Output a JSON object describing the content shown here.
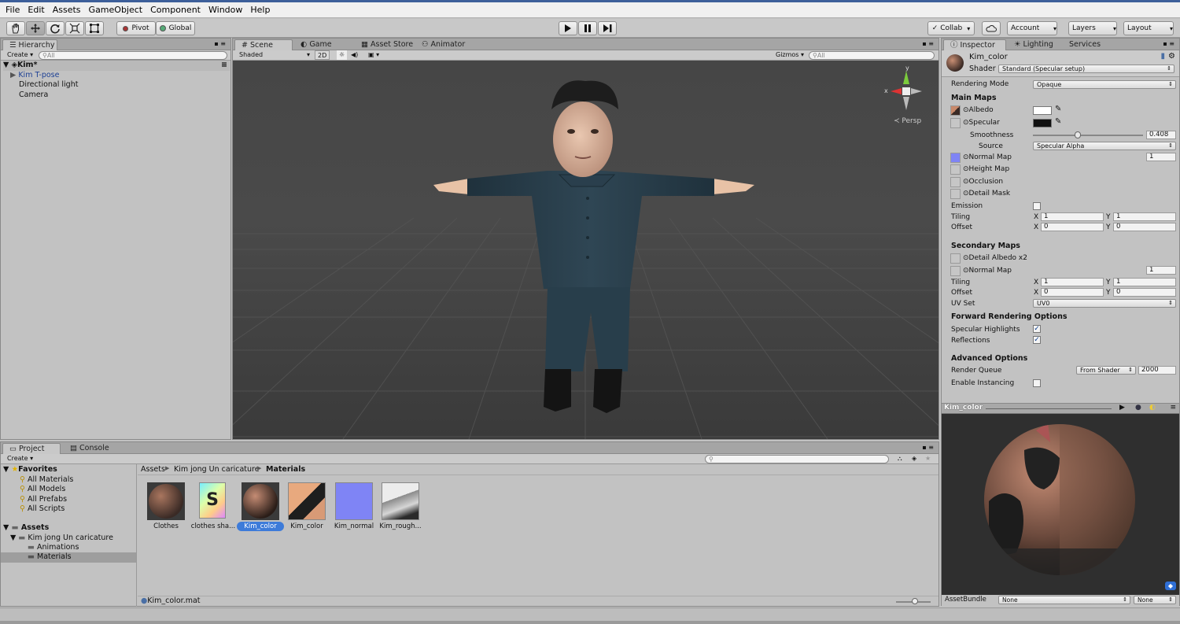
{
  "menu": [
    "File",
    "Edit",
    "Assets",
    "GameObject",
    "Component",
    "Window",
    "Help"
  ],
  "toolbar": {
    "pivot": "Pivot",
    "global": "Global",
    "collab": "Collab",
    "account": "Account",
    "layers": "Layers",
    "layout": "Layout"
  },
  "hierarchy": {
    "tab": "Hierarchy",
    "create": "Create",
    "search_placeholder": "All",
    "scene": "Kim*",
    "items": [
      "Kim T-pose",
      "Directional light",
      "Camera"
    ]
  },
  "scene_view": {
    "tabs": [
      "Scene",
      "Game",
      "Asset Store",
      "Animator"
    ],
    "shading": "Shaded",
    "mode_2d": "2D",
    "gizmos": "Gizmos",
    "search_placeholder": "All",
    "persp": "Persp",
    "axis_y": "y",
    "axis_x": "x"
  },
  "inspector": {
    "tabs": [
      "Inspector",
      "Lighting",
      "Services"
    ],
    "material_name": "Kim_color",
    "shader_label": "Shader",
    "shader_value": "Standard (Specular setup)",
    "rendering_mode_label": "Rendering Mode",
    "rendering_mode_value": "Opaque",
    "main_maps": "Main Maps",
    "albedo": "Albedo",
    "specular": "Specular",
    "smoothness": "Smoothness",
    "smoothness_value": "0.408",
    "smoothness_level": 0.408,
    "source": "Source",
    "source_value": "Specular Alpha",
    "normal_map": "Normal Map",
    "normal_value": "1",
    "height_map": "Height Map",
    "occlusion": "Occlusion",
    "detail_mask": "Detail Mask",
    "emission": "Emission",
    "tiling": "Tiling",
    "offset": "Offset",
    "x": "X",
    "y": "Y",
    "tiling_x": "1",
    "tiling_y": "1",
    "offset_x": "0",
    "offset_y": "0",
    "secondary_maps": "Secondary Maps",
    "detail_albedo": "Detail Albedo x2",
    "normal_map2": "Normal Map",
    "normal2_value": "1",
    "tiling2_x": "1",
    "tiling2_y": "1",
    "offset2_x": "0",
    "offset2_y": "0",
    "uv_set": "UV Set",
    "uv_set_value": "UV0",
    "forward_rendering": "Forward Rendering Options",
    "specular_highlights": "Specular Highlights",
    "reflections": "Reflections",
    "advanced": "Advanced Options",
    "render_queue": "Render Queue",
    "render_queue_mode": "From Shader",
    "render_queue_value": "2000",
    "enable_instancing": "Enable Instancing",
    "preview_title": "Kim_color",
    "asset_bundle": "AssetBundle",
    "bundle_value": "None",
    "bundle_variant": "None"
  },
  "project": {
    "tabs": [
      "Project",
      "Console"
    ],
    "create": "Create",
    "favorites_label": "Favorites",
    "favorites": [
      "All Materials",
      "All Models",
      "All Prefabs",
      "All Scripts"
    ],
    "assets_label": "Assets",
    "folders": [
      "Kim jong Un caricature",
      "Animations",
      "Materials"
    ],
    "breadcrumb": [
      "Assets",
      "Kim jong Un caricature",
      "Materials"
    ],
    "items": [
      "Clothes",
      "clothes sha...",
      "Kim_color",
      "Kim_color",
      "Kim_normal",
      "Kim_rough..."
    ],
    "selected_file": "Kim_color.mat"
  },
  "colors": {
    "accent": "#3d7bd9",
    "panel_bg": "#c2c2c2",
    "viewport_bg": "#3e3e3e",
    "suit": "#2a3f4d",
    "normal_map_color": "#7f84f5"
  }
}
